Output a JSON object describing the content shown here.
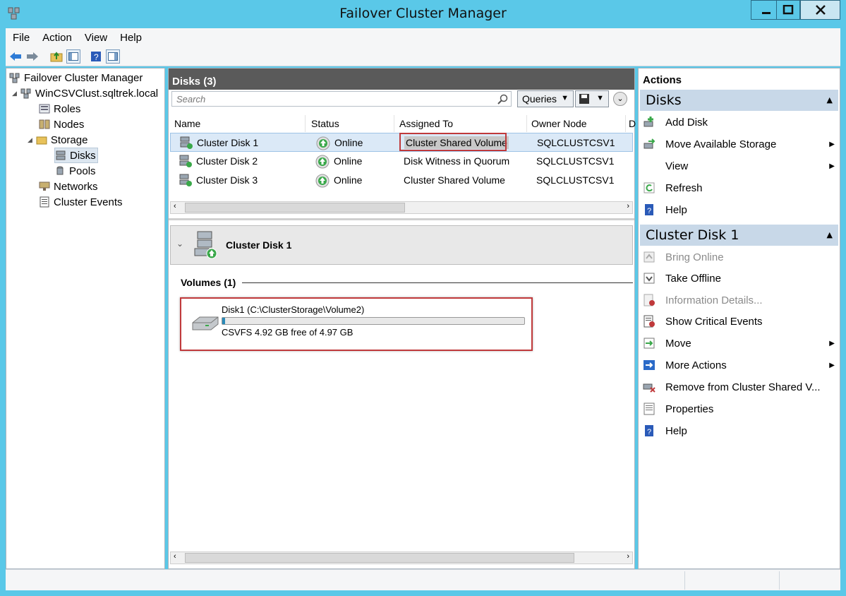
{
  "window": {
    "title": "Failover Cluster Manager"
  },
  "menu": [
    "File",
    "Action",
    "View",
    "Help"
  ],
  "tree": {
    "root": "Failover Cluster Manager",
    "cluster": "WinCSVClust.sqltrek.local",
    "roles": "Roles",
    "nodes": "Nodes",
    "storage": "Storage",
    "disks": "Disks",
    "pools": "Pools",
    "networks": "Networks",
    "events": "Cluster Events"
  },
  "center": {
    "header": "Disks (3)",
    "search_placeholder": "Search",
    "queries": "Queries",
    "columns": [
      "Name",
      "Status",
      "Assigned To",
      "Owner Node",
      "D"
    ],
    "rows": [
      {
        "name": "Cluster Disk 1",
        "status": "Online",
        "assigned": "Cluster Shared Volume",
        "owner": "SQLCLUSTCSV1"
      },
      {
        "name": "Cluster Disk 2",
        "status": "Online",
        "assigned": "Disk Witness in Quorum",
        "owner": "SQLCLUSTCSV1"
      },
      {
        "name": "Cluster Disk 3",
        "status": "Online",
        "assigned": "Cluster Shared Volume",
        "owner": "SQLCLUSTCSV1"
      }
    ],
    "detail_title": "Cluster Disk 1",
    "volumes_title": "Volumes (1)",
    "volume": {
      "name": "Disk1 (C:\\ClusterStorage\\Volume2)",
      "info": "CSVFS 4.92 GB free of 4.97 GB",
      "used_fraction": 0.01
    }
  },
  "actions": {
    "title": "Actions",
    "disks_section": "Disks",
    "disks_items": [
      "Add Disk",
      "Move Available Storage",
      "View",
      "Refresh",
      "Help"
    ],
    "disk_section": "Cluster Disk 1",
    "disk_items": [
      "Bring Online",
      "Take Offline",
      "Information Details...",
      "Show Critical Events",
      "Move",
      "More Actions",
      "Remove from Cluster Shared V...",
      "Properties",
      "Help"
    ]
  },
  "colors": {
    "titlebar": "#5ac8e8",
    "highlight": "#c0393b",
    "online": "#3aa84a"
  }
}
